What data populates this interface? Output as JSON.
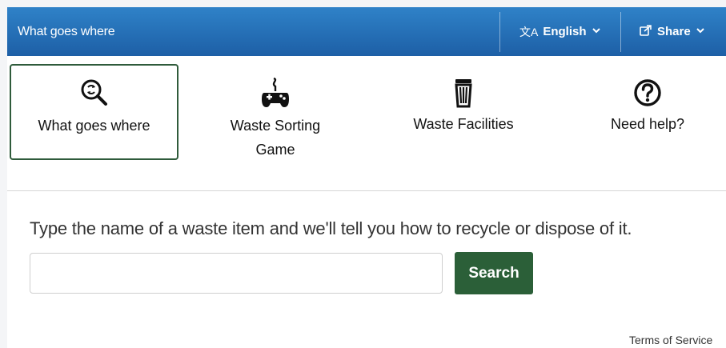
{
  "header": {
    "title": "What goes where",
    "language_label": "English",
    "language_icon": "translate-icon",
    "share_label": "Share",
    "share_icon": "share-icon",
    "bar_color": "#2f82c8"
  },
  "nav": {
    "items": [
      {
        "label": "What goes where",
        "icon": "recycle-search-icon",
        "active": true
      },
      {
        "label": "Waste Sorting",
        "label_line2": "Game",
        "icon": "game-controller-icon",
        "active": false
      },
      {
        "label": "Waste Facilities",
        "icon": "trash-can-icon",
        "active": false
      },
      {
        "label": "Need help?",
        "icon": "help-circle-icon",
        "active": false
      }
    ],
    "active_border_color": "#2f5b3b"
  },
  "search": {
    "intro": "Type the name of a waste item and we'll tell you how to recycle or dispose of it.",
    "input_value": "",
    "button_label": "Search",
    "button_color": "#2b5f38"
  },
  "footer": {
    "terms_label": "Terms of Service"
  }
}
